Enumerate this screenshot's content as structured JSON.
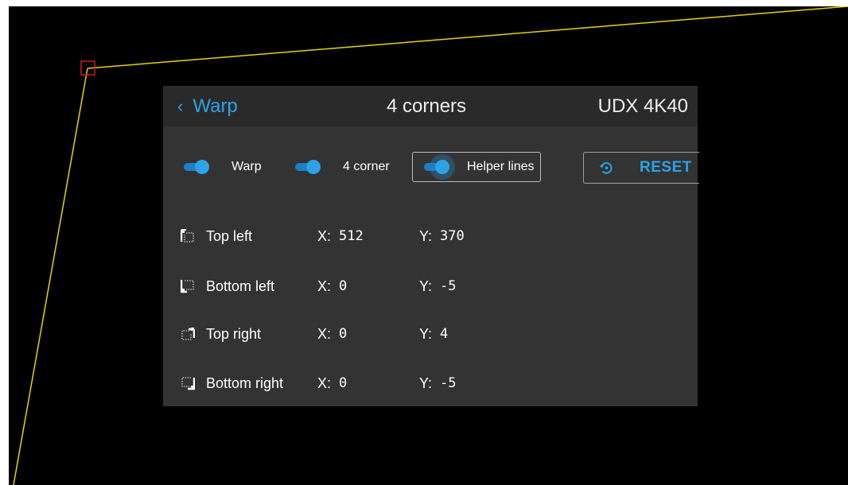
{
  "header": {
    "back_label": "Warp",
    "title": "4 corners",
    "model": "UDX 4K40"
  },
  "toggles": [
    {
      "label": "Warp",
      "on": true
    },
    {
      "label": "4 corner",
      "on": true
    },
    {
      "label": "Helper lines",
      "on": true
    }
  ],
  "reset": {
    "label": "RESET",
    "icon": "reset-icon"
  },
  "corners": [
    {
      "name": "Top left",
      "icon": "corner-top-left-icon",
      "x_axis": "X:",
      "x": "512",
      "y_axis": "Y:",
      "y": "370"
    },
    {
      "name": "Bottom left",
      "icon": "corner-bottom-left-icon",
      "x_axis": "X:",
      "x": "0",
      "y_axis": "Y:",
      "y": "-5"
    },
    {
      "name": "Top right",
      "icon": "corner-top-right-icon",
      "x_axis": "X:",
      "x": "0",
      "y_axis": "Y:",
      "y": "4"
    },
    {
      "name": "Bottom right",
      "icon": "corner-bottom-right-icon",
      "x_axis": "X:",
      "x": "0",
      "y_axis": "Y:",
      "y": "-5"
    }
  ],
  "colors": {
    "accent": "#2aa3e8",
    "helper_line": "#e8d400",
    "corner_marker": "#d81b1b",
    "panel": "#333333",
    "header": "#2a2a2a"
  }
}
